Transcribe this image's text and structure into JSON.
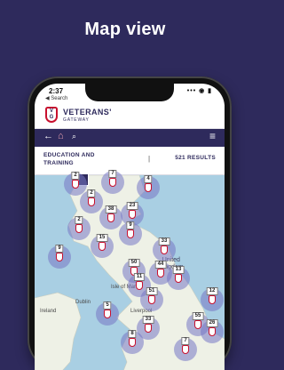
{
  "hero": {
    "title": "Map view"
  },
  "status": {
    "time": "2:37",
    "back_app": "◀ Search",
    "icons": "••• ◉ ▮"
  },
  "brand": {
    "logo_text": "V\nG",
    "name": "VETERANS'",
    "sub": "GATEWAY"
  },
  "nav": {
    "back": "←",
    "home": "⌂",
    "search": "⌕",
    "menu": "≡"
  },
  "filter": {
    "category": "EDUCATION AND TRAINING",
    "separator": "|",
    "results": "521 RESULTS"
  },
  "map_labels": {
    "uk_line1": "United",
    "uk_line2": "Kingdom",
    "isle_of_man": "Isle of Man",
    "dublin": "Dublin",
    "ireland": "Ireland",
    "liverpool": "Liverpool"
  },
  "clusters": [
    "2",
    "7",
    "2",
    "4",
    "38",
    "23",
    "2",
    "9",
    "15",
    "33",
    "9",
    "50",
    "44",
    "13",
    "11",
    "51",
    "12",
    "5",
    "33",
    "55",
    "26",
    "7",
    "8"
  ],
  "colors": {
    "brand_navy": "#2e2a5c",
    "brand_red": "#c8102e",
    "cluster": "#7676c4",
    "water": "#a9cfe3"
  }
}
